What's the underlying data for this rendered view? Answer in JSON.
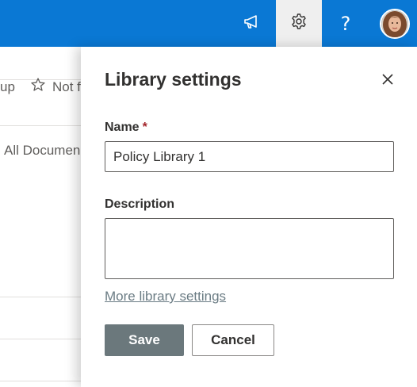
{
  "colors": {
    "suite_bar": "#0a78d4",
    "settings_active_bg": "#efefef",
    "save_button_bg": "#6b787c",
    "required_asterisk": "#a4262c",
    "link": "#6b7c84"
  },
  "suite_bar": {
    "icons": [
      "megaphone-icon",
      "gear-icon",
      "help-icon",
      "avatar"
    ],
    "help_glyph": "?"
  },
  "background_page": {
    "partial_group_text": "up",
    "not_following_text": "Not f",
    "view_text": "All Documen"
  },
  "panel": {
    "title": "Library settings",
    "close_icon": "close-icon",
    "name_label": "Name",
    "required_marker": "*",
    "name_value": "Policy Library 1",
    "description_label": "Description",
    "description_value": "",
    "more_settings_link": "More library settings",
    "save_label": "Save",
    "cancel_label": "Cancel"
  }
}
